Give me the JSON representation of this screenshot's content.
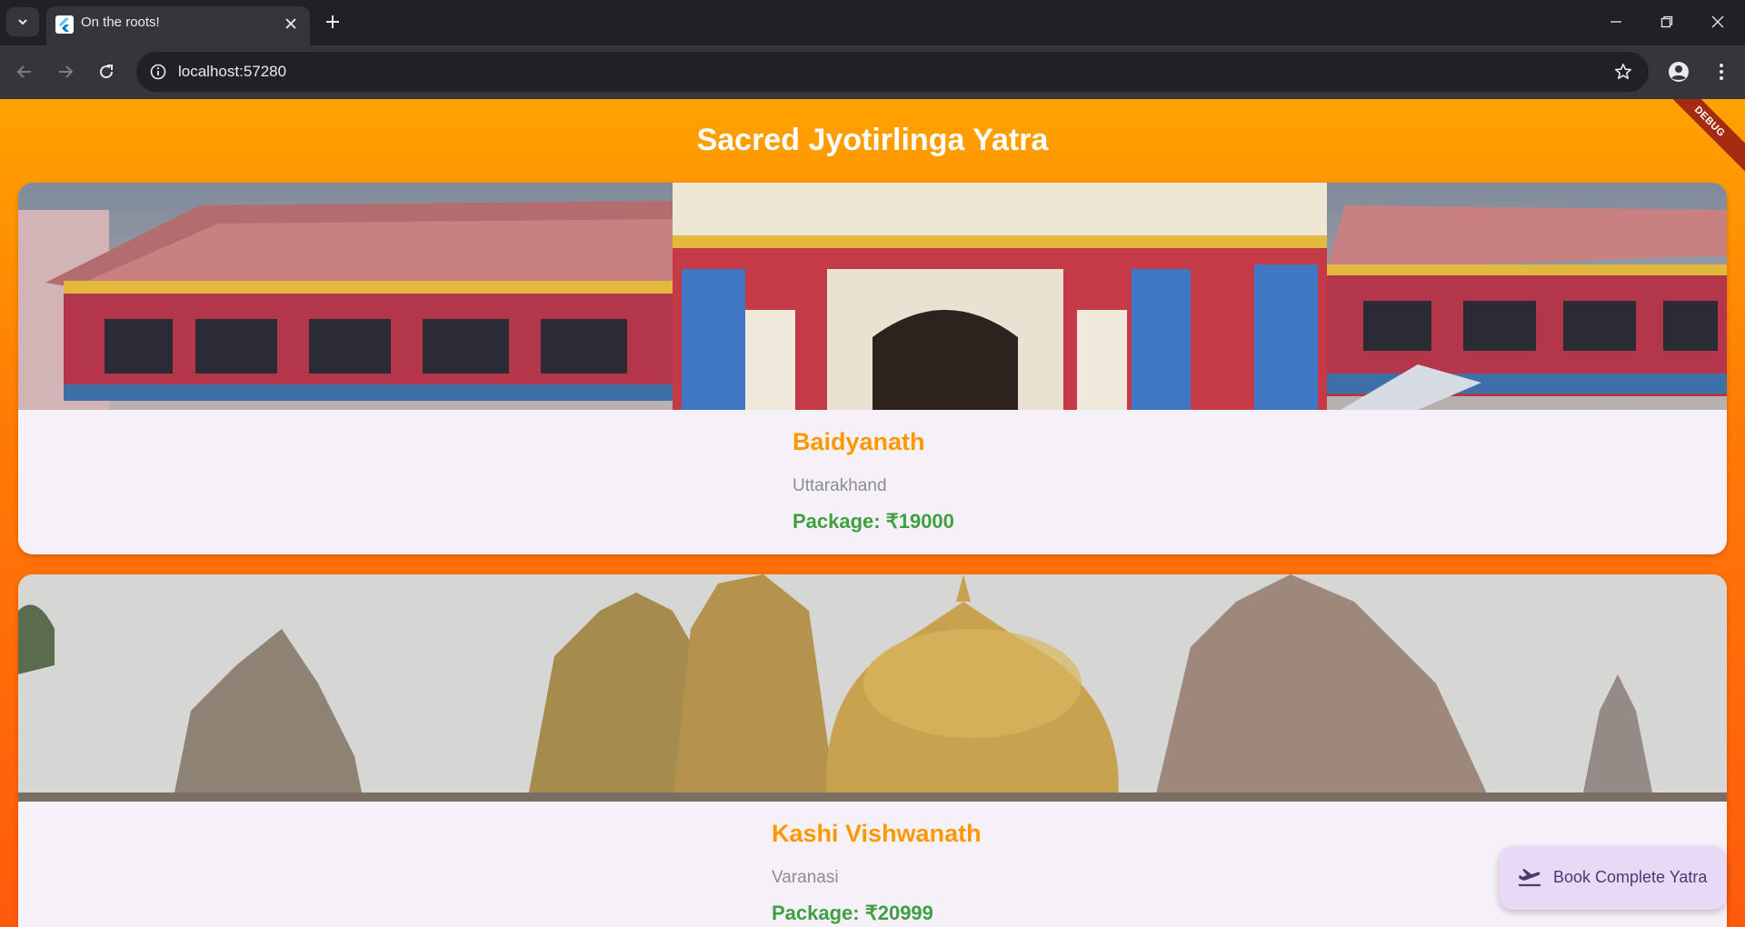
{
  "browser": {
    "tab_title": "On the roots!",
    "url": "localhost:57280",
    "icons": {
      "tab_search": "chevron-down-icon",
      "favicon": "flutter-icon",
      "close_tab": "close-icon",
      "new_tab": "plus-icon",
      "back": "arrow-left-icon",
      "forward": "arrow-right-icon",
      "reload": "reload-icon",
      "site_info": "info-icon",
      "bookmark": "star-icon",
      "profile": "person-icon",
      "menu": "kebab-menu-icon",
      "minimize": "minimize-icon",
      "restore": "restore-icon",
      "close_window": "close-icon"
    }
  },
  "app": {
    "title": "Sacred Jyotirlinga Yatra",
    "debug_banner": "DEBUG",
    "colors": {
      "gradient_top": "#ffa200",
      "gradient_bottom": "#ff5a0c",
      "card_background": "#f6f1f8",
      "temple_name": "#ff9800",
      "price": "#3fa043",
      "location": "#8d8d8d"
    },
    "temples": [
      {
        "name": "Baidyanath",
        "location": "Uttarakhand",
        "price": "Package: ₹19000",
        "image": "temple-facade-photo"
      },
      {
        "name": "Kashi Vishwanath",
        "location": "Varanasi",
        "price": "Package: ₹20999",
        "image": "temple-spires-photo"
      }
    ],
    "fab": {
      "label": "Book Complete Yatra",
      "icon": "flight-takeoff-icon"
    }
  }
}
